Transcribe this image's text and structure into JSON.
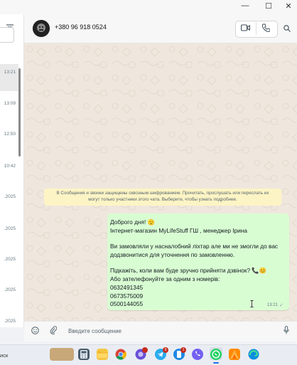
{
  "window": {
    "minimize_glyph": "—",
    "maximize_glyph": "☐",
    "close_glyph": "✕"
  },
  "sidebar": {
    "chat_times": [
      "13:21",
      "13:09",
      "12:50",
      "10:42",
      ".2025",
      ".2025",
      ".2025",
      ".2025",
      ".2025"
    ]
  },
  "header": {
    "contact_name": "+380 96 918 0524"
  },
  "chat": {
    "encryption_notice_line1": "В Сообщения и звонки защищены сквозным шифрованием. Прочитать, прослушать или переслать их",
    "encryption_notice_line2": "могут только участники этого чата. Выберите, чтобы узнать подробнее.",
    "message": {
      "lines": [
        "Доброго дня! 🫡",
        "Інтернет-магазин MyLifeStuff ГШ , менеджер Ірина",
        "",
        "Ви замовляли у насналобний ліхтар але ми не змогли до вас",
        "додзвонитися для уточнення по замовленню.",
        "",
        "Підкажіть, коли вам буде зручно прийняти дзвінок? 📞😊",
        "Або зателефонуйте за одним з номерів:",
        "0632491345",
        "0673575009",
        "0500144055"
      ],
      "time": "13:21",
      "status": "✓"
    }
  },
  "composer": {
    "placeholder": "Введите сообщение"
  },
  "taskbar": {
    "search_text": "иск",
    "badges": {
      "telegram": "9",
      "phone_link": "1"
    }
  },
  "colors": {
    "chat_bg": "#efe7dd",
    "bubble": "#d9fdd3",
    "notice_bg": "#fdf4c5",
    "accent": "#25d366"
  }
}
